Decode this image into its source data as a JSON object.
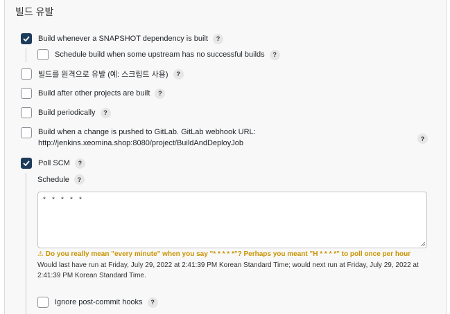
{
  "section": {
    "title": "빌드 유발"
  },
  "triggers": {
    "snapshot": {
      "label": "Build whenever a SNAPSHOT dependency is built",
      "checked": true
    },
    "schedule_upstream": {
      "label": "Schedule build when some upstream has no successful builds",
      "checked": false
    },
    "remote": {
      "label": "빌드를 원격으로 유발 (예: 스크립트 사용)",
      "checked": false
    },
    "after_other": {
      "label": "Build after other projects are built",
      "checked": false
    },
    "periodically": {
      "label": "Build periodically",
      "checked": false
    },
    "gitlab": {
      "label_line1": "Build when a change is pushed to GitLab. GitLab webhook URL:",
      "label_line2": "http://jenkins.xeomina.shop:8080/project/BuildAndDeployJob",
      "checked": false
    },
    "poll_scm": {
      "label": "Poll SCM",
      "checked": true
    },
    "ignore_post_commit": {
      "label": "Ignore post-commit hooks",
      "checked": false
    }
  },
  "help": {
    "glyph": "?"
  },
  "poll": {
    "schedule_label": "Schedule",
    "schedule_value": "* * * * *",
    "warning": "Do you really mean \"every minute\" when you say \"* * * * *\"? Perhaps you meant \"H * * * *\" to poll once per hour",
    "warning_icon": "⚠",
    "info_line1": "Would last have run at Friday, July 29, 2022 at 2:41:39 PM Korean Standard Time; would next run at Friday, July 29, 2022 at",
    "info_line2": "2:41:39 PM Korean Standard Time."
  },
  "colors": {
    "checkbox_checked": "#1d3b5a",
    "warning": "#c99400"
  }
}
